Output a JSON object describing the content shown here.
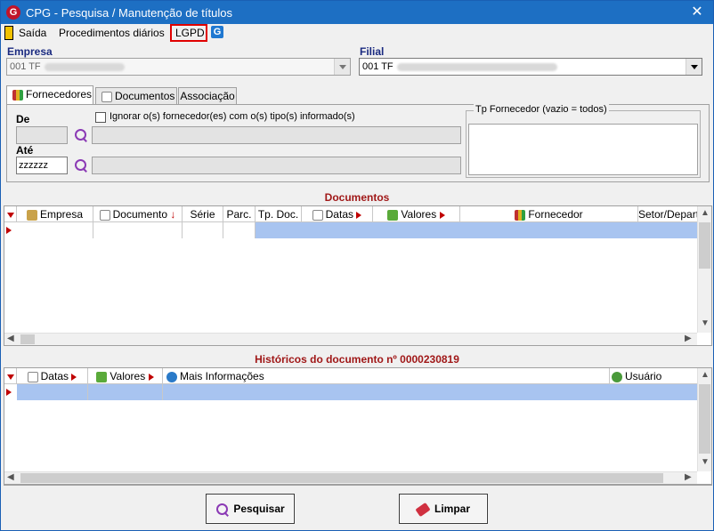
{
  "window": {
    "title": "CPG - Pesquisa / Manutenção de títulos",
    "close": "✕",
    "app_icon": "G"
  },
  "menu": {
    "items": [
      "Saída",
      "Procedimentos diários",
      "LGPD"
    ],
    "g_icon": "G"
  },
  "empresa": {
    "label": "Empresa",
    "value": "001 TF"
  },
  "filial": {
    "label": "Filial",
    "value": "001 TF"
  },
  "tabs": [
    "Fornecedores",
    "Documentos",
    "Associação"
  ],
  "filters": {
    "de_label": "De",
    "ate_label": "Até",
    "de_value": "",
    "ate_value": "zzzzzz",
    "ignore_checkbox": "Ignorar o(s) fornecedor(es) com o(s) tipo(s) informado(s)",
    "tp_fornecedor": "Tp Fornecedor (vazio = todos)"
  },
  "documentos": {
    "title": "Documentos",
    "columns": [
      "Empresa",
      "Documento",
      "Série",
      "Parc.",
      "Tp. Doc.",
      "Datas",
      "Valores",
      "Fornecedor",
      "Setor/Depart"
    ]
  },
  "historicos": {
    "title": "Históricos do documento nº 0000230819",
    "columns": [
      "Datas",
      "Valores",
      "Mais Informações",
      "Usuário"
    ]
  },
  "buttons": {
    "pesquisar": "Pesquisar",
    "limpar": "Limpar"
  },
  "colors": {
    "accent": "#1d6fc3",
    "section_title": "#a01818",
    "selected_row": "#a8c4f0",
    "lgpd_highlight": "#e00000"
  }
}
